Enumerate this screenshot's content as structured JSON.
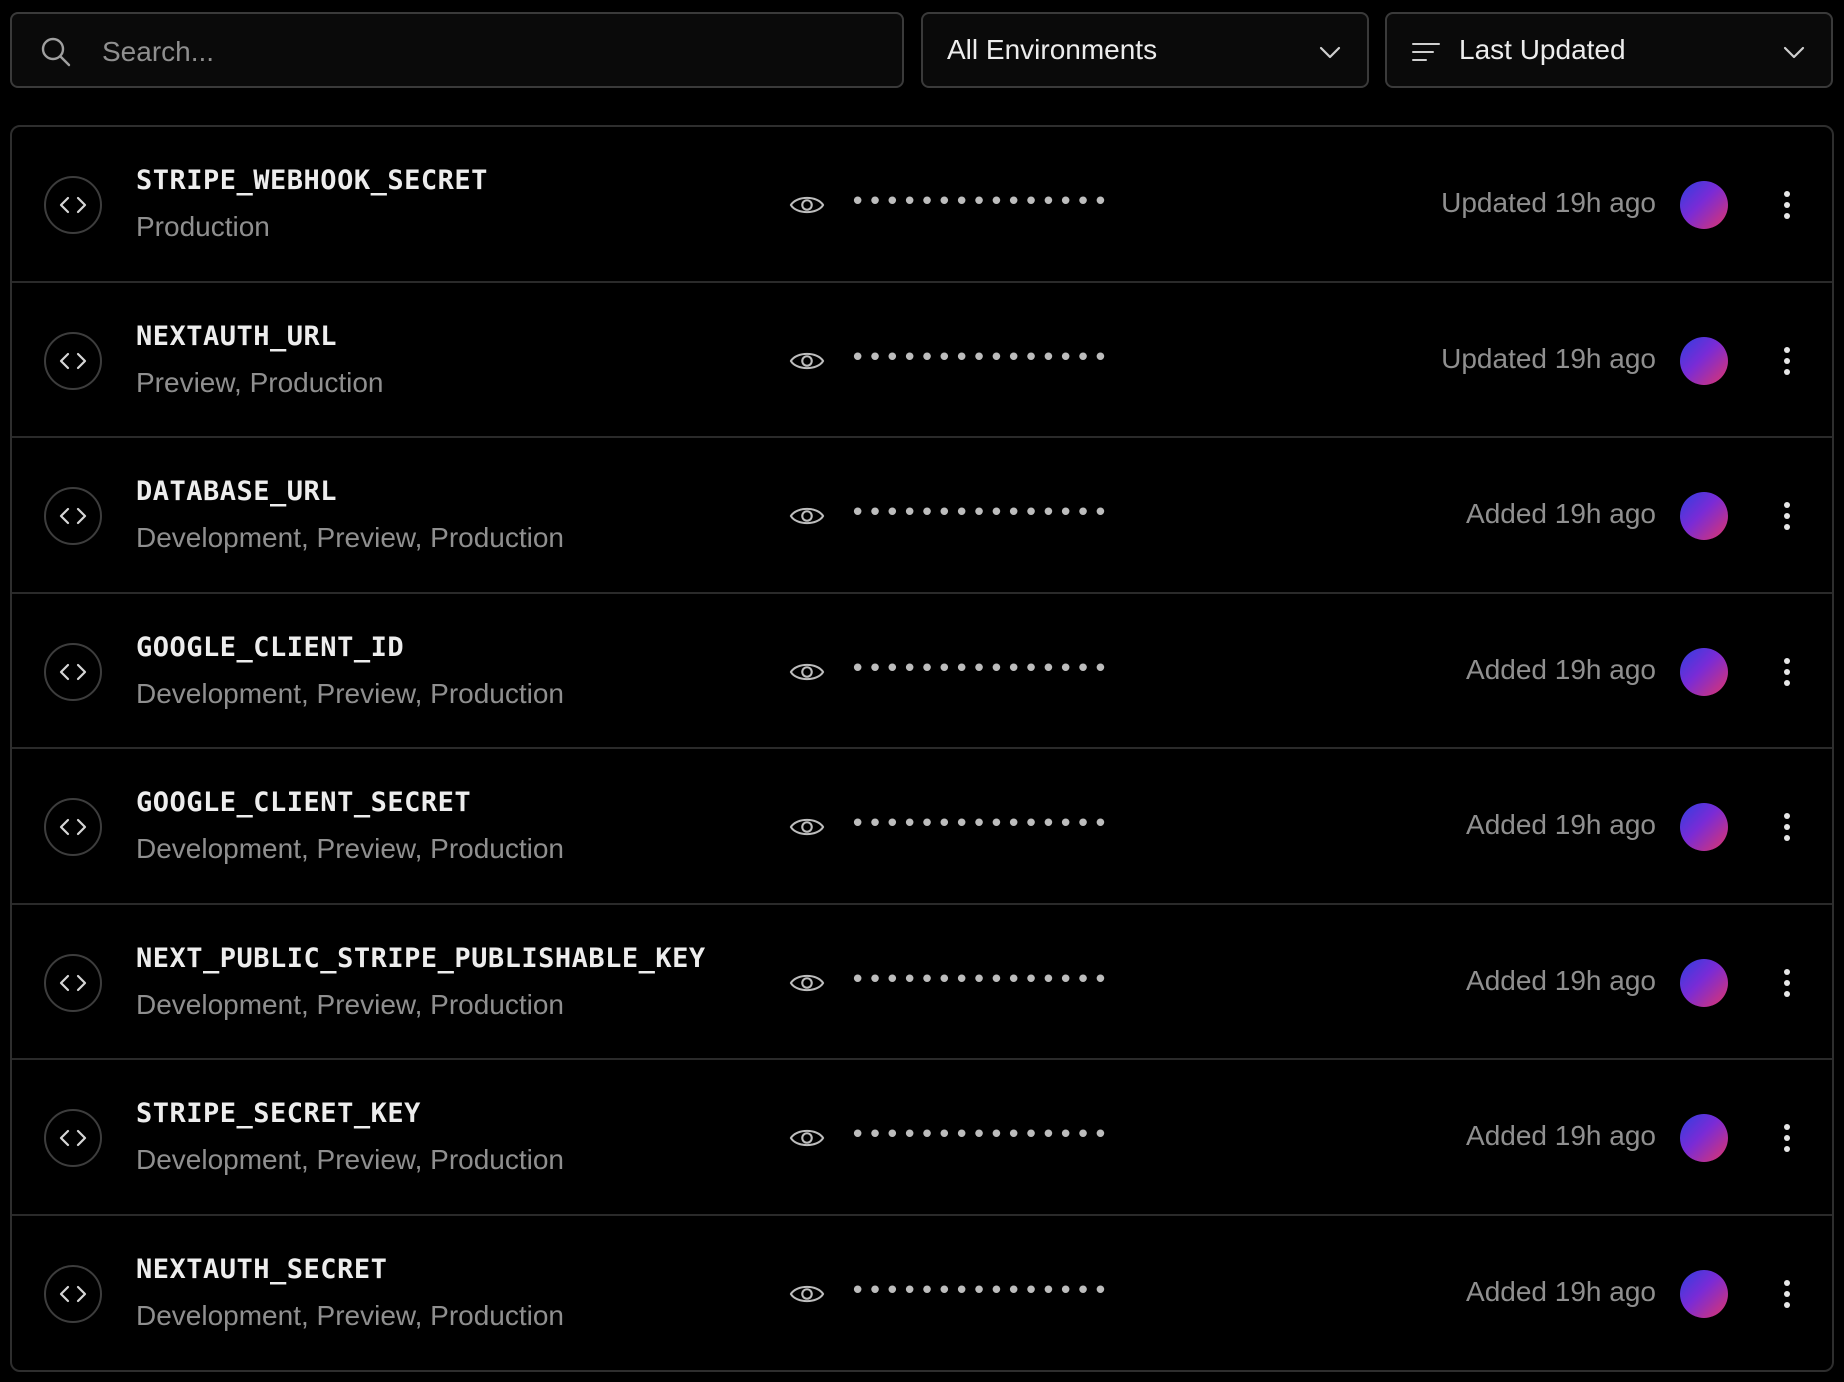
{
  "search": {
    "placeholder": "Search...",
    "value": ""
  },
  "filters": {
    "environment": "All Environments",
    "sort": "Last Updated"
  },
  "colors": {
    "background": "#000000",
    "border": "#2e2e2e",
    "text_primary": "#ededed",
    "text_secondary": "#8f8f8f",
    "avatar_gradient": [
      "#2f3fe0",
      "#7a2bd6",
      "#e0356a"
    ]
  },
  "icons": {
    "search": "search-icon",
    "chevron": "chevron-down-icon",
    "sort": "sort-lines-icon",
    "variable": "code-brackets-icon",
    "reveal": "eye-icon",
    "menu": "more-vertical-icon"
  },
  "env_vars": {
    "items": [
      {
        "name": "STRIPE_WEBHOOK_SECRET",
        "environments": "Production",
        "masked": "•••••••••••••••",
        "timestamp": "Updated 19h ago"
      },
      {
        "name": "NEXTAUTH_URL",
        "environments": "Preview, Production",
        "masked": "•••••••••••••••",
        "timestamp": "Updated 19h ago"
      },
      {
        "name": "DATABASE_URL",
        "environments": "Development, Preview, Production",
        "masked": "•••••••••••••••",
        "timestamp": "Added 19h ago"
      },
      {
        "name": "GOOGLE_CLIENT_ID",
        "environments": "Development, Preview, Production",
        "masked": "•••••••••••••••",
        "timestamp": "Added 19h ago"
      },
      {
        "name": "GOOGLE_CLIENT_SECRET",
        "environments": "Development, Preview, Production",
        "masked": "•••••••••••••••",
        "timestamp": "Added 19h ago"
      },
      {
        "name": "NEXT_PUBLIC_STRIPE_PUBLISHABLE_KEY",
        "environments": "Development, Preview, Production",
        "masked": "•••••••••••••••",
        "timestamp": "Added 19h ago"
      },
      {
        "name": "STRIPE_SECRET_KEY",
        "environments": "Development, Preview, Production",
        "masked": "•••••••••••••••",
        "timestamp": "Added 19h ago"
      },
      {
        "name": "NEXTAUTH_SECRET",
        "environments": "Development, Preview, Production",
        "masked": "•••••••••••••••",
        "timestamp": "Added 19h ago"
      }
    ]
  }
}
